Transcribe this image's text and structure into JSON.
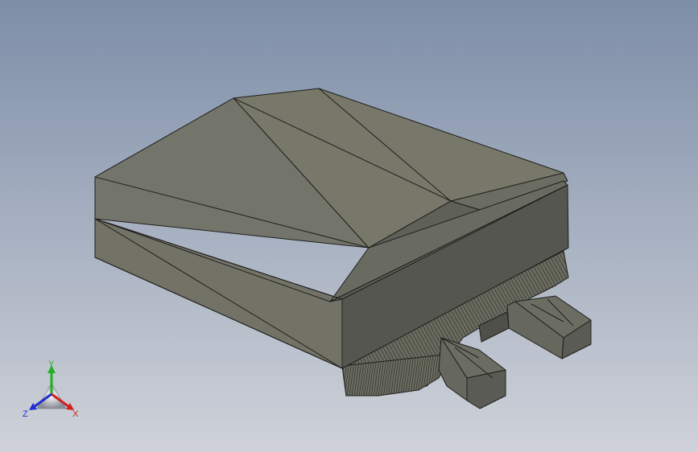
{
  "viewport": {
    "background_top": "#7d8ea8",
    "background_bottom": "#c9cdd6"
  },
  "model": {
    "face_top": "#727366",
    "face_front_left": "#6f7064",
    "face_right": "#5e5f57",
    "face_dark": "#4f504a",
    "edge": "#1f1f1c",
    "tab_face": "#6a6b60"
  },
  "triad": {
    "x_label": "X",
    "y_label": "Y",
    "z_label": "Z",
    "x_color": "#d02020",
    "y_color": "#20b020",
    "z_color": "#2030d0"
  }
}
